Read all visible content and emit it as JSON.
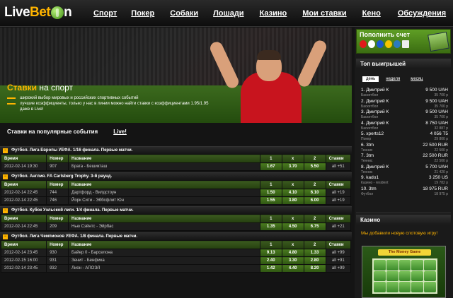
{
  "logo": {
    "part1": "Live",
    "part2": "Bet",
    "part3": "n"
  },
  "nav": [
    "Спорт",
    "Покер",
    "Собаки",
    "Лошади",
    "Казино",
    "Мои ставки",
    "Кено",
    "Обсуждения"
  ],
  "hero": {
    "title_a": "Ставки",
    "title_b": " на спорт",
    "bullets": [
      "широкий выбор мировых и российских спортивных событий",
      "лучшие коэффициенты, только у нас в линии можно найти ставки с коэффициентами 1.95/1.95 даже в Live!"
    ]
  },
  "tabs": [
    "Ставки на популярные события",
    "Live!"
  ],
  "table_headers": {
    "time": "Время",
    "num": "Номер",
    "name": "Название",
    "o1": "1",
    "ox": "x",
    "o2": "2",
    "bets": "Ставки"
  },
  "events": [
    {
      "title": "Футбол. Лига Европы УЕФА. 1/16 финала. Первые матчи.",
      "rows": [
        [
          "2012-02-14 19:30",
          "907",
          "Брага - Бешикташ",
          "1.67",
          "3.70",
          "5.50",
          "all +51"
        ]
      ]
    },
    {
      "title": "Футбол. Англия. FA Carlsberg Trophy. 3-й раунд.",
      "rows": [
        [
          "2012-02-14 22:45",
          "744",
          "Дартфорд - Вилдстоун",
          "1.50",
          "4.10",
          "6.10",
          "all +19"
        ],
        [
          "2012-02-14 22:45",
          "746",
          "Йорк Сити - Эббсфлит Юн",
          "1.55",
          "3.80",
          "6.00",
          "all +19"
        ]
      ]
    },
    {
      "title": "Футбол. Кубок Уэльской лиги. 1/4 финала. Первые матчи.",
      "rows": [
        [
          "2012-02-14 22:45",
          "209",
          "Нью Сэйнтс - Эйрбас",
          "1.35",
          "4.50",
          "6.75",
          "all +21"
        ]
      ]
    },
    {
      "title": "Футбол. Лига Чемпионов УЕФА. 1/8 финала. Первые матчи.",
      "rows": [
        [
          "2012-02-14 23:45",
          "930",
          "Байер 0 - Барселона",
          "9.13",
          "4.80",
          "1.33",
          "all +99"
        ],
        [
          "2012-02-15 16:00",
          "931",
          "Зенит - Бенфика",
          "2.40",
          "3.30",
          "2.80",
          "all +91"
        ],
        [
          "2012-02-14 23:45",
          "932",
          "Лион - АПОЭЛ",
          "1.42",
          "4.40",
          "8.20",
          "all +99"
        ]
      ]
    }
  ],
  "deposit": {
    "title": "Пополнить счет"
  },
  "winners": {
    "title": "Топ выигрышей",
    "tabs": [
      "день",
      "неделя",
      "месяц"
    ],
    "rows": [
      {
        "name": "1. Дмитрий К",
        "amount": "9 500 UAH",
        "game": "Баскетбол",
        "sub": "35 700 р"
      },
      {
        "name": "2. Дмитрий К",
        "amount": "9 500 UAH",
        "game": "Баскетбол",
        "sub": "35 700 р"
      },
      {
        "name": "3. Дмитрий К",
        "amount": "9 500 UAH",
        "game": "Баскетбол",
        "sub": "35 700 р"
      },
      {
        "name": "4. Дмитрий К",
        "amount": "8 750 UAH",
        "game": "Баскетбол",
        "sub": "32 887 р"
      },
      {
        "name": "5. xperts12",
        "amount": "4 056 T5",
        "game": "Покер",
        "sub": "29 800 р"
      },
      {
        "name": "6. 3tm",
        "amount": "22 500 RUR",
        "game": "Теннис",
        "sub": "22 500 р"
      },
      {
        "name": "7. 3tm",
        "amount": "22 500 RUR",
        "game": "Теннис",
        "sub": "22 500 р"
      },
      {
        "name": "8. Дмитрий К",
        "amount": "5 700 UAH",
        "game": "Теннис",
        "sub": "21 420 р"
      },
      {
        "name": "9. kado1",
        "amount": "3 250 US",
        "game": "Казино - resident",
        "sub": "19 782 р"
      },
      {
        "name": "10. 3tm",
        "amount": "18 975 RUR",
        "game": "Футбол",
        "sub": "18 975 р"
      }
    ]
  },
  "casino": {
    "title": "Казино",
    "desc": "Мы добавили новую слотовую игру!",
    "game": "The Money Game"
  }
}
